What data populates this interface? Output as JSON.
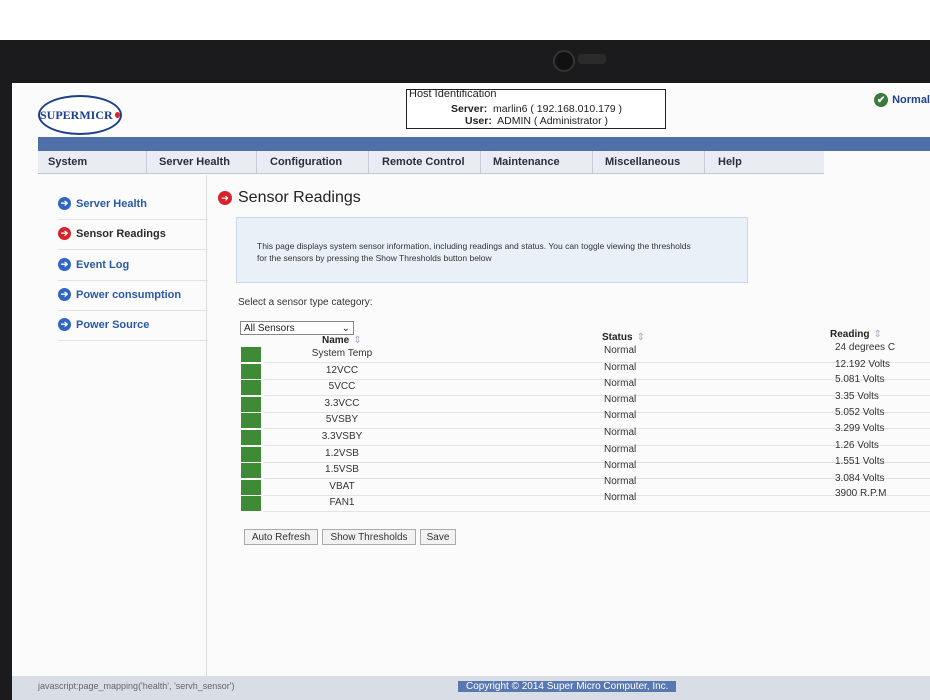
{
  "header": {
    "logo_text": "SUPERMICR",
    "host_title": "Host Identification",
    "server_label": "Server:",
    "server_value": "marlin6  ( 192.168.010.179 )",
    "user_label": "User:",
    "user_value": "ADMIN    ( Administrator )",
    "status": "Normal"
  },
  "menu": [
    "System",
    "Server Health",
    "Configuration",
    "Remote Control",
    "Maintenance",
    "Miscellaneous",
    "Help"
  ],
  "sidebar": {
    "items": [
      {
        "label": "Server Health"
      },
      {
        "label": "Sensor Readings"
      },
      {
        "label": "Event Log"
      },
      {
        "label": "Power consumption"
      },
      {
        "label": "Power Source"
      }
    ]
  },
  "main": {
    "title": "Sensor Readings",
    "info": "This page displays system sensor information, including readings and status. You can toggle viewing the thresholds for the sensors by pressing the Show Thresholds button below",
    "select_label": "Select a sensor type category:",
    "select_value": "All Sensors",
    "columns": {
      "name": "Name",
      "status": "Status",
      "reading": "Reading"
    },
    "rows": [
      {
        "name": "System Temp",
        "status": "Normal",
        "reading": "24 degrees C"
      },
      {
        "name": "12VCC",
        "status": "Normal",
        "reading": "12.192 Volts"
      },
      {
        "name": "5VCC",
        "status": "Normal",
        "reading": "5.081 Volts"
      },
      {
        "name": "3.3VCC",
        "status": "Normal",
        "reading": "3.35 Volts"
      },
      {
        "name": "5VSBY",
        "status": "Normal",
        "reading": "5.052 Volts"
      },
      {
        "name": "3.3VSBY",
        "status": "Normal",
        "reading": "3.299 Volts"
      },
      {
        "name": "1.2VSB",
        "status": "Normal",
        "reading": "1.26 Volts"
      },
      {
        "name": "1.5VSB",
        "status": "Normal",
        "reading": "1.551 Volts"
      },
      {
        "name": "VBAT",
        "status": "Normal",
        "reading": "3.084 Volts"
      },
      {
        "name": "FAN1",
        "status": "Normal",
        "reading": "3900 R.P.M"
      }
    ],
    "buttons": {
      "refresh": "Auto Refresh",
      "thresholds": "Show Thresholds",
      "save": "Save"
    }
  },
  "footer": {
    "url": "javascript:page_mapping('health', 'servh_sensor')",
    "copyright": "Copyright © 2014 Super Micro Computer, Inc."
  },
  "colors": {
    "accent": "#4f6fa9",
    "status_ok": "#3f8a35",
    "link": "#2a5aa7",
    "active": "#d6252a"
  }
}
